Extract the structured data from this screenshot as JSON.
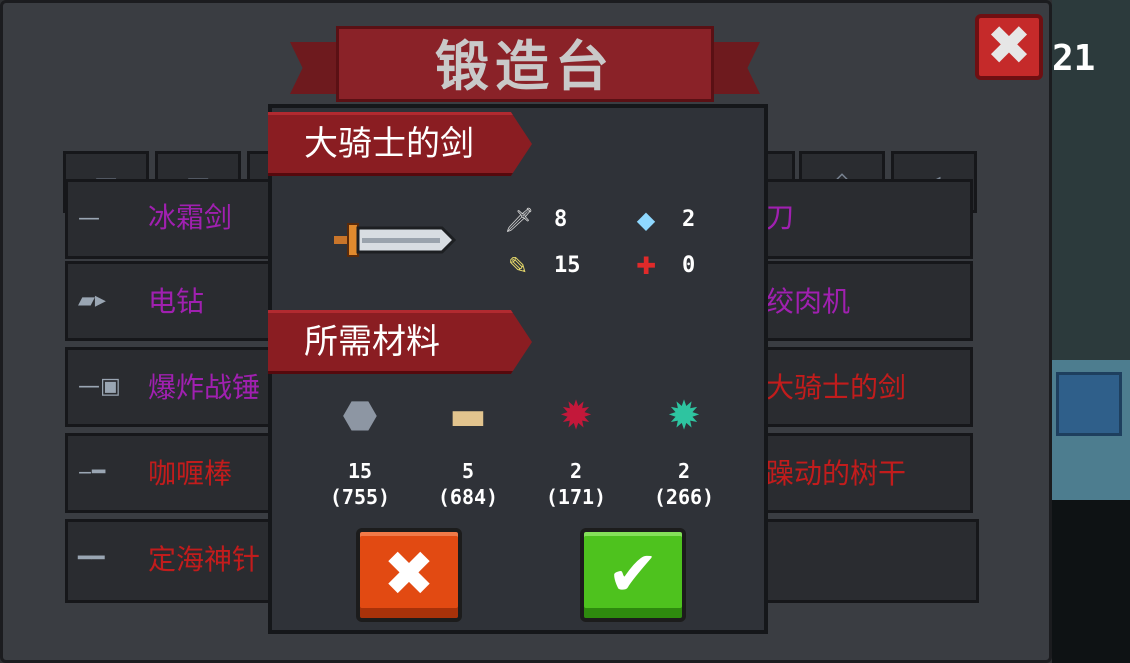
{
  "hud": {
    "level_number": "21"
  },
  "forge": {
    "title": "锻造台",
    "close_icon": "✖"
  },
  "tabs": [
    {
      "icon": "pistol-icon",
      "glyph": "▬"
    },
    {
      "icon": "rifle-icon",
      "glyph": "▭"
    },
    {
      "icon": "melee-icon",
      "glyph": "▸"
    },
    {
      "icon": "gun-icon",
      "glyph": "▬"
    },
    {
      "icon": "target-icon",
      "glyph": "◇"
    },
    {
      "icon": "fish-icon",
      "glyph": "◂"
    }
  ],
  "list_left": [
    {
      "name": "冰霜剑",
      "color": "purple",
      "icon": "ice-sword-icon",
      "glyph": "—"
    },
    {
      "name": "电钻",
      "color": "purple",
      "icon": "drill-icon",
      "glyph": "▰▸"
    },
    {
      "name": "爆炸战锤",
      "color": "purple",
      "icon": "hammer-icon",
      "glyph": "—▣"
    },
    {
      "name": "咖喱棒",
      "color": "red",
      "icon": "curry-stick-icon",
      "glyph": "‒━"
    },
    {
      "name": "定海神针",
      "color": "red",
      "icon": "staff-icon",
      "glyph": "━━"
    }
  ],
  "list_right": [
    {
      "name": "刀",
      "color": "purple"
    },
    {
      "name": "绞肉机",
      "color": "purple"
    },
    {
      "name": "大骑士的剑",
      "color": "red"
    },
    {
      "name": "躁动的树干",
      "color": "red"
    }
  ],
  "dialog": {
    "weapon_name": "大骑士的剑",
    "weapon_icon": "sword-icon",
    "stats": [
      {
        "icon": "damage-icon",
        "glyph": "🗡",
        "value": "8"
      },
      {
        "icon": "energy-cost-icon",
        "glyph": "◆",
        "value": "2"
      },
      {
        "icon": "crit-icon",
        "glyph": "✎",
        "value": "15"
      },
      {
        "icon": "accuracy-icon",
        "glyph": "✚",
        "value": "0"
      }
    ],
    "materials_title": "所需材料",
    "materials": [
      {
        "icon": "ore-icon",
        "glyph": "⬣",
        "color": "#8d96a3",
        "required": "15",
        "owned": "(755)"
      },
      {
        "icon": "wood-icon",
        "glyph": "▬",
        "color": "#e2c48e",
        "required": "5",
        "owned": "(684)"
      },
      {
        "icon": "red-leaf-icon",
        "glyph": "✹",
        "color": "#c3183a",
        "required": "2",
        "owned": "(171)"
      },
      {
        "icon": "green-leaf-icon",
        "glyph": "✹",
        "color": "#2ec4a0",
        "required": "2",
        "owned": "(266)"
      }
    ],
    "cancel_icon": "✖",
    "confirm_icon": "✔"
  }
}
